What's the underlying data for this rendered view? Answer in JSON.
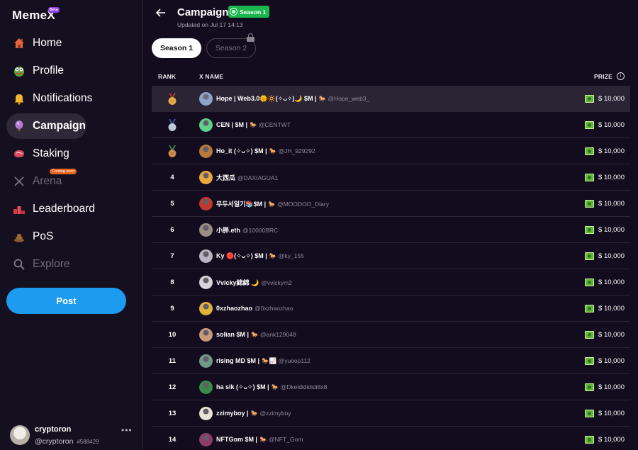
{
  "app": {
    "logo": "MemeX",
    "logo_badge": "Beta"
  },
  "sidebar": {
    "items": [
      {
        "label": "Home",
        "icon": "house-icon"
      },
      {
        "label": "Profile",
        "icon": "frog-icon"
      },
      {
        "label": "Notifications",
        "icon": "bell-icon"
      },
      {
        "label": "Campaign",
        "icon": "balloon-icon"
      },
      {
        "label": "Staking",
        "icon": "steak-icon"
      },
      {
        "label": "Arena",
        "icon": "swords-icon",
        "badge": "Coming soon"
      },
      {
        "label": "Leaderboard",
        "icon": "podium-icon"
      },
      {
        "label": "PoS",
        "icon": "poop-icon"
      },
      {
        "label": "Explore",
        "icon": "magnifier-icon"
      }
    ],
    "post_label": "Post",
    "user": {
      "name": "cryptoron",
      "handle": "@cryptoron",
      "id": "#588429",
      "more": "•••"
    }
  },
  "header": {
    "title": "Campaign",
    "season_badge": "Season 1",
    "updated": "Updated on Jul 17 14:13"
  },
  "tabs": [
    "Season 1",
    "Season 2"
  ],
  "table": {
    "columns": {
      "rank": "RANK",
      "name": "X NAME",
      "prize": "PRIZE"
    },
    "rows": [
      {
        "rank": "1",
        "name": "Hope | Web3.0🌞🔆(✧ᴗ✧)🌙 $M |",
        "handle": "🐎 @Hope_web3_",
        "prize": "$ 10,000",
        "color": "#8fa3c8"
      },
      {
        "rank": "2",
        "name": "CEN | $M |",
        "handle": "🐎 @CENTWT",
        "prize": "$ 10,000",
        "color": "#5fd18a"
      },
      {
        "rank": "3",
        "name": "Ho_it (✧ᴗ✧) $M |",
        "handle": "🐎 @JH_929292",
        "prize": "$ 10,000",
        "color": "#b87a3a"
      },
      {
        "rank": "4",
        "name": "大西瓜",
        "handle": "@DAXIAGUA1",
        "prize": "$ 10,000",
        "color": "#e8a93a"
      },
      {
        "rank": "5",
        "name": "무두서일기📚$M |",
        "handle": "🐎 @MOODOO_Diary",
        "prize": "$ 10,000",
        "color": "#c0392b"
      },
      {
        "rank": "6",
        "name": "小胖.eth",
        "handle": "@10000BRC",
        "prize": "$ 10,000",
        "color": "#9a8f84"
      },
      {
        "rank": "7",
        "name": "Ky 🔴(✧ᴗ✧) $M |",
        "handle": "🐎 @ky_155",
        "prize": "$ 10,000",
        "color": "#b9b4c4"
      },
      {
        "rank": "8",
        "name": "Vvicky綿綿 🌙",
        "handle": "@vvickym2",
        "prize": "$ 10,000",
        "color": "#d8d4dc"
      },
      {
        "rank": "9",
        "name": "0xzhaozhao",
        "handle": "@0xzhaozhao",
        "prize": "$ 10,000",
        "color": "#e0b13b"
      },
      {
        "rank": "10",
        "name": "solian $M |",
        "handle": "🐎 @ank129048",
        "prize": "$ 10,000",
        "color": "#c79a7a"
      },
      {
        "rank": "11",
        "name": "rising MD $M |",
        "handle": "🐎📈 @yuoop112",
        "prize": "$ 10,000",
        "color": "#6f9a8a"
      },
      {
        "rank": "12",
        "name": "ha sik (✧ᴗ✧) $M |",
        "handle": "🐎 @Dkeididididi8x8",
        "prize": "$ 10,000",
        "color": "#3c8a4a"
      },
      {
        "rank": "13",
        "name": "zzimyboy |",
        "handle": "🐎 @zzimyboy",
        "prize": "$ 10,000",
        "color": "#e9e2d6"
      },
      {
        "rank": "14",
        "name": "NFTGom $M |",
        "handle": "🐎 @NFT_Gom",
        "prize": "$ 10,000",
        "color": "#8e3b6a"
      }
    ]
  },
  "colors": {
    "accent_blue": "#1d9bf0",
    "season_green": "#1bb64d",
    "gold": "#d9a233",
    "silver": "#b8c2d4",
    "bronze": "#c17a3c"
  }
}
